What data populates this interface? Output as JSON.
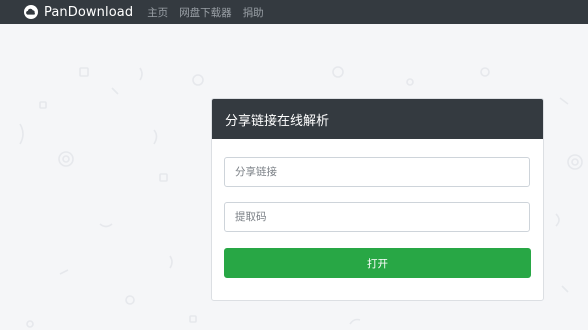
{
  "navbar": {
    "brand_icon": "cloud-icon",
    "brand_name": "PanDownload",
    "links": [
      "主页",
      "网盘下载器",
      "捐助"
    ]
  },
  "form": {
    "title": "分享链接在线解析",
    "share_link": {
      "placeholder": "分享链接",
      "value": ""
    },
    "extract_code": {
      "placeholder": "提取码",
      "value": ""
    },
    "submit_label": "打开"
  },
  "colors": {
    "navbar_bg": "#343a40",
    "page_bg": "#f5f6f8",
    "button_green": "#28a745"
  }
}
